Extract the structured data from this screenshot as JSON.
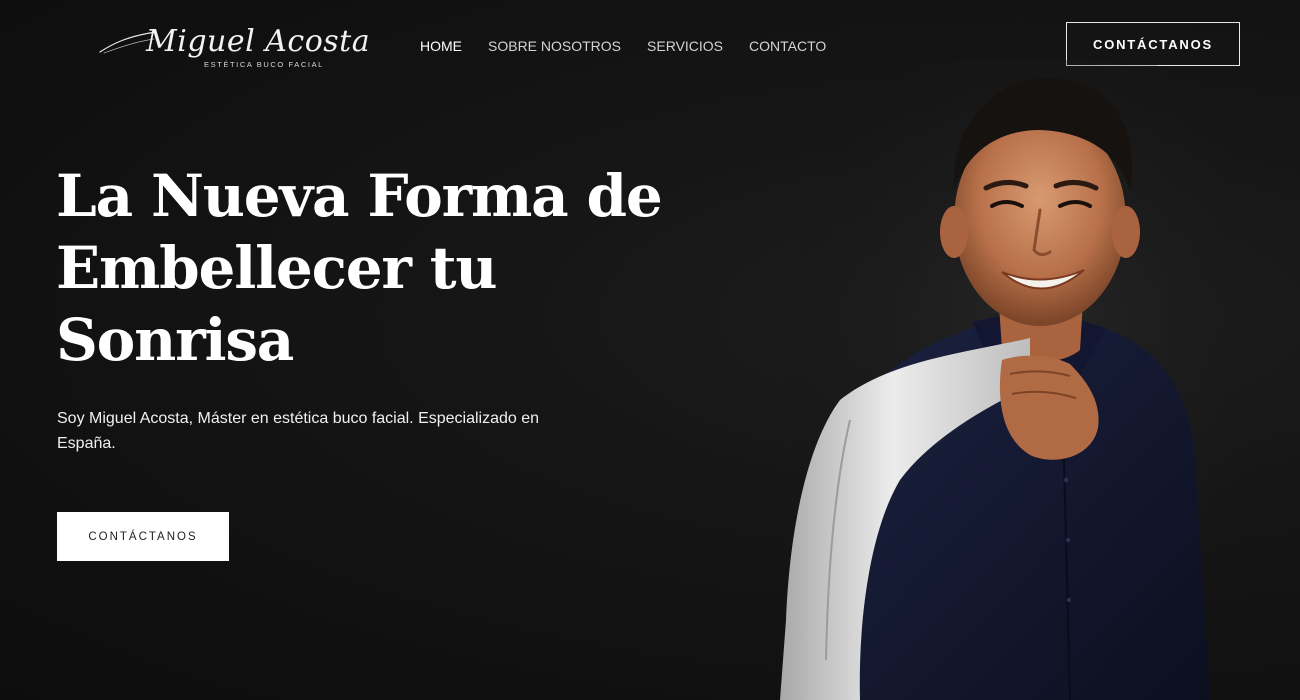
{
  "header": {
    "logo": {
      "name": "Miguel Acosta",
      "tagline": "ESTÉTICA BUCO FACIAL"
    },
    "nav": [
      {
        "label": "HOME",
        "active": true
      },
      {
        "label": "SOBRE NOSOTROS",
        "active": false
      },
      {
        "label": "SERVICIOS",
        "active": false
      },
      {
        "label": "CONTACTO",
        "active": false
      }
    ],
    "cta_label": "CONTÁCTANOS"
  },
  "hero": {
    "title": "La Nueva Forma de Embellecer tu Sonrisa",
    "subtitle": "Soy Miguel Acosta, Máster en estética buco facial. Especializado en España.",
    "cta_label": "CONTÁCTANOS"
  },
  "colors": {
    "background": "#121212",
    "text": "#ffffff",
    "button_bg": "#ffffff",
    "button_text": "#222222",
    "shirt": "#151a33",
    "jacket": "#e4e4e4"
  }
}
